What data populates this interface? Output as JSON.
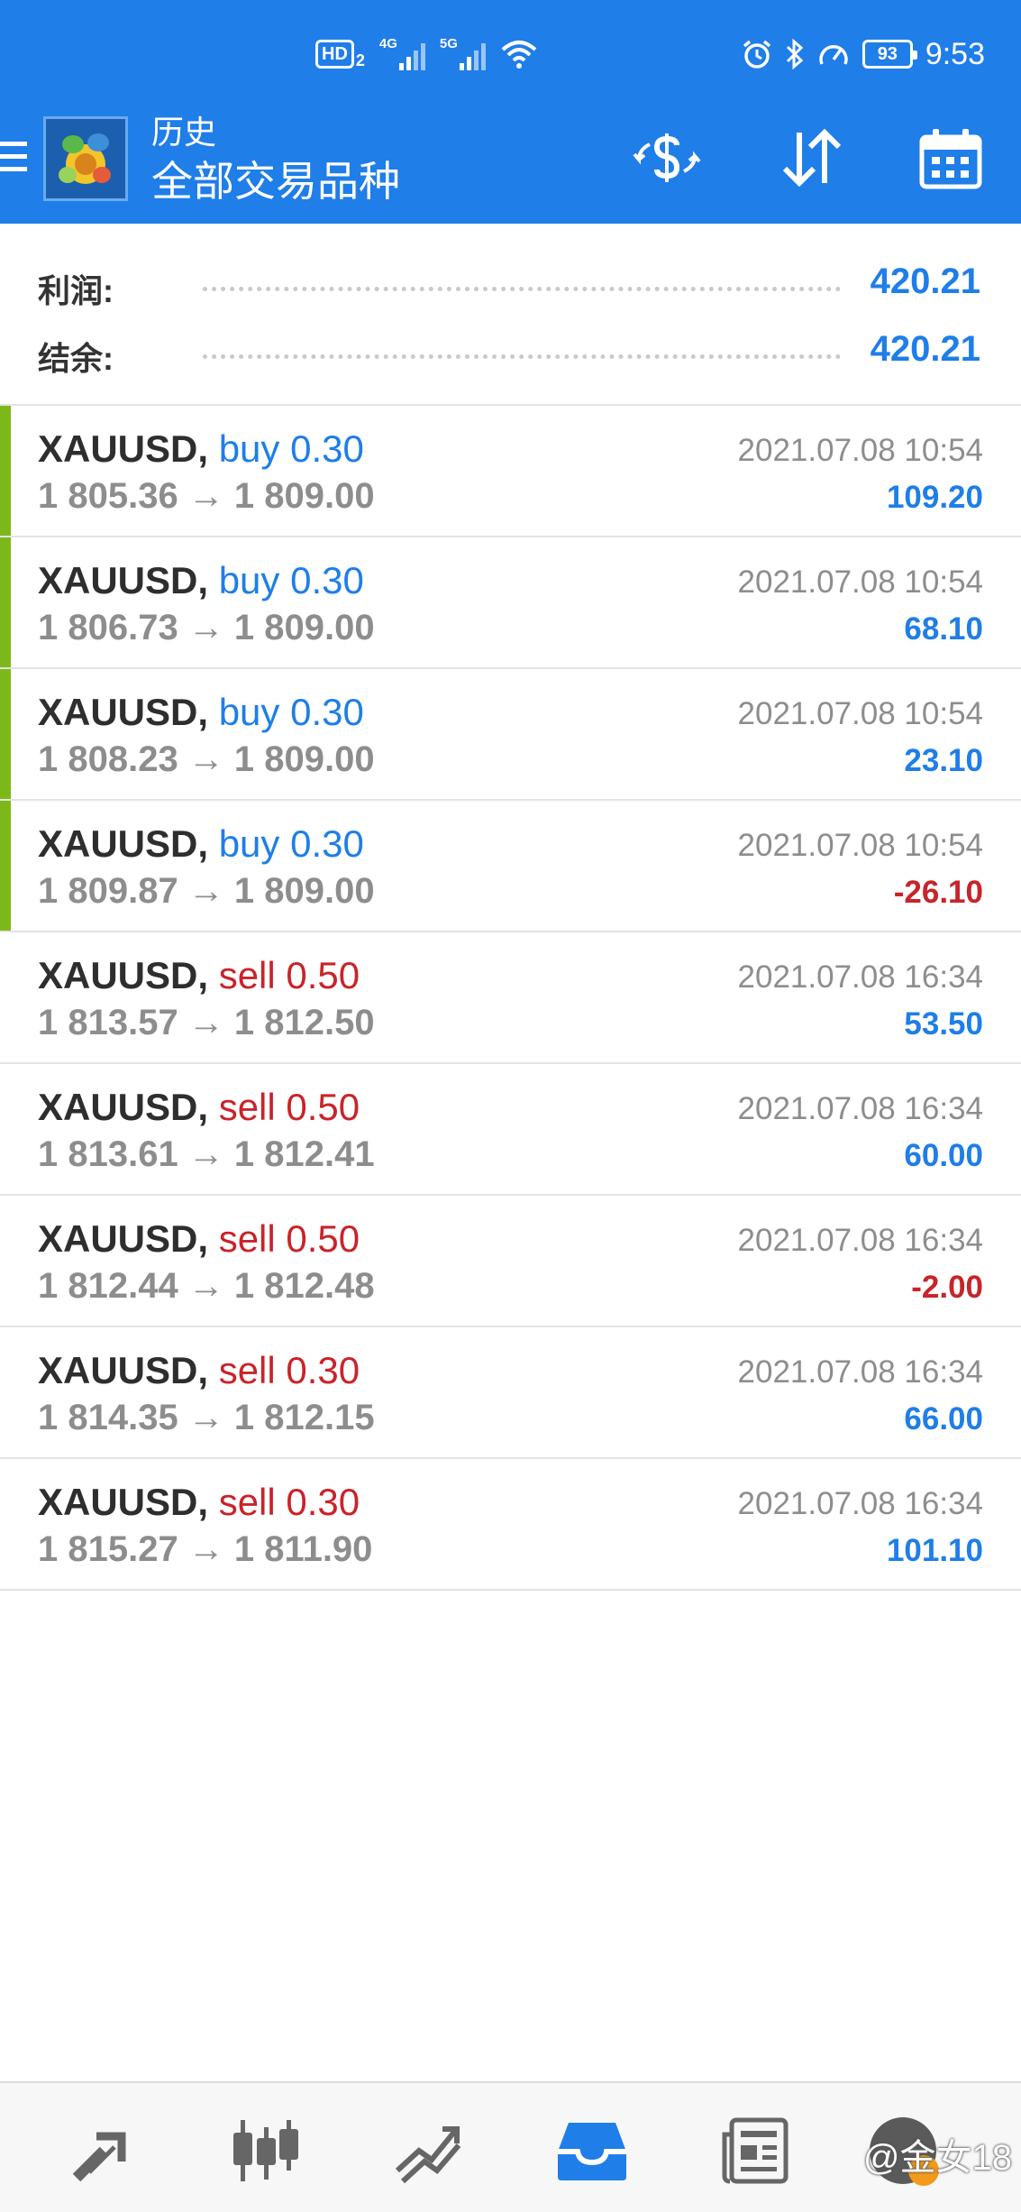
{
  "status_bar": {
    "hd_label": "HD",
    "hd_sub": "2",
    "network1": "4G",
    "network2": "5G",
    "battery": "93",
    "time": "9:53"
  },
  "app_bar": {
    "subtitle": "历史",
    "title": "全部交易品种"
  },
  "summary": {
    "profit_label": "利润:",
    "profit_value": "420.21",
    "balance_label": "结余:",
    "balance_value": "420.21"
  },
  "deals": [
    {
      "symbol": "XAUUSD,",
      "side": "buy 0.30",
      "prices": "1 805.36 → 1 809.00",
      "time": "2021.07.08 10:54",
      "profit": "109.20"
    },
    {
      "symbol": "XAUUSD,",
      "side": "buy 0.30",
      "prices": "1 806.73 → 1 809.00",
      "time": "2021.07.08 10:54",
      "profit": "68.10"
    },
    {
      "symbol": "XAUUSD,",
      "side": "buy 0.30",
      "prices": "1 808.23 → 1 809.00",
      "time": "2021.07.08 10:54",
      "profit": "23.10"
    },
    {
      "symbol": "XAUUSD,",
      "side": "buy 0.30",
      "prices": "1 809.87 → 1 809.00",
      "time": "2021.07.08 10:54",
      "profit": "-26.10"
    },
    {
      "symbol": "XAUUSD,",
      "side": "sell 0.50",
      "prices": "1 813.57 → 1 812.50",
      "time": "2021.07.08 16:34",
      "profit": "53.50"
    },
    {
      "symbol": "XAUUSD,",
      "side": "sell 0.50",
      "prices": "1 813.61 → 1 812.41",
      "time": "2021.07.08 16:34",
      "profit": "60.00"
    },
    {
      "symbol": "XAUUSD,",
      "side": "sell 0.50",
      "prices": "1 812.44 → 1 812.48",
      "time": "2021.07.08 16:34",
      "profit": "-2.00"
    },
    {
      "symbol": "XAUUSD,",
      "side": "sell 0.30",
      "prices": "1 814.35 → 1 812.15",
      "time": "2021.07.08 16:34",
      "profit": "66.00"
    },
    {
      "symbol": "XAUUSD,",
      "side": "sell 0.30",
      "prices": "1 815.27 → 1 811.90",
      "time": "2021.07.08 16:34",
      "profit": "101.10"
    }
  ],
  "bottom_nav": {
    "items": [
      "quotes-icon",
      "chart-icon",
      "trade-icon",
      "history-icon",
      "news-icon",
      "chat-icon"
    ],
    "active": "history-icon",
    "watermark": "@金女18"
  },
  "colors": {
    "accent": "#1f7ee8",
    "loss": "#c8242a",
    "buy_marker": "#7db81b",
    "muted": "#8d8d8d"
  }
}
